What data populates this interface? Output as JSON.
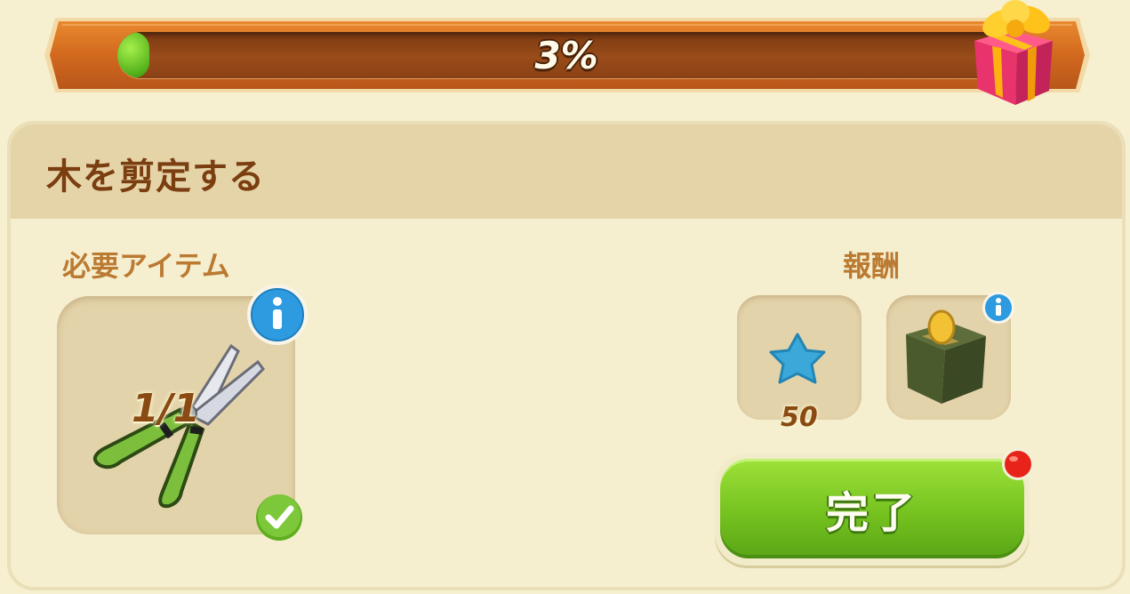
{
  "progress": {
    "percent_label": "3%",
    "value": 0.03
  },
  "task": {
    "title": "木を剪定する"
  },
  "required": {
    "label": "必要アイテム",
    "item_icon": "pruning-shears-icon",
    "count": "1/1",
    "complete": true
  },
  "rewards": {
    "label": "報酬",
    "items": [
      {
        "icon": "blue-star-icon",
        "count": "50"
      },
      {
        "icon": "coin-box-icon",
        "count": ""
      }
    ]
  },
  "complete_button": {
    "label": "完了",
    "has_notification": true
  },
  "colors": {
    "accent_green": "#75c21f",
    "banner_orange": "#d2691e",
    "title_brown": "#7a3e10",
    "label_tan": "#bb7a32",
    "notification_red": "#e8231a"
  }
}
